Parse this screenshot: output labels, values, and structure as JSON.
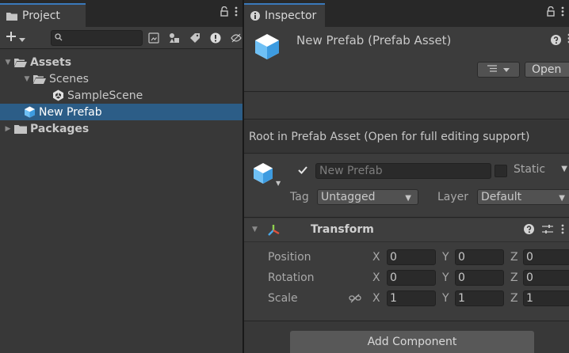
{
  "project": {
    "tab_label": "Project",
    "search_placeholder": "",
    "tree": [
      {
        "label": "Assets",
        "depth": 0,
        "expanded": true,
        "bold": true,
        "icon": "folder-open-icon"
      },
      {
        "label": "Scenes",
        "depth": 1,
        "expanded": true,
        "bold": false,
        "icon": "folder-open-icon"
      },
      {
        "label": "SampleScene",
        "depth": 2,
        "bold": false,
        "icon": "unity-scene-icon"
      },
      {
        "label": "New Prefab",
        "depth": 1,
        "bold": false,
        "icon": "prefab-icon",
        "selected": true
      },
      {
        "label": "Packages",
        "depth": 0,
        "expanded": false,
        "bold": true,
        "icon": "folder-icon"
      }
    ]
  },
  "inspector": {
    "tab_label": "Inspector",
    "title": "New Prefab (Prefab Asset)",
    "open_label": "Open",
    "root_message": "Root in Prefab Asset (Open for full editing support)",
    "gameobject": {
      "name": "New Prefab",
      "active": true,
      "static_label": "Static",
      "tag_label": "Tag",
      "tag_value": "Untagged",
      "layer_label": "Layer",
      "layer_value": "Default"
    },
    "transform": {
      "title": "Transform",
      "rows": [
        {
          "label": "Position",
          "x": "0",
          "y": "0",
          "z": "0"
        },
        {
          "label": "Rotation",
          "x": "0",
          "y": "0",
          "z": "0"
        },
        {
          "label": "Scale",
          "x": "1",
          "y": "1",
          "z": "1"
        }
      ],
      "axis_x": "X",
      "axis_y": "Y",
      "axis_z": "Z"
    },
    "add_component_label": "Add Component"
  },
  "colors": {
    "selection": "#2c5d87",
    "prefab_blue": "#4aa8e8",
    "tab_accent": "#3a79bb"
  }
}
